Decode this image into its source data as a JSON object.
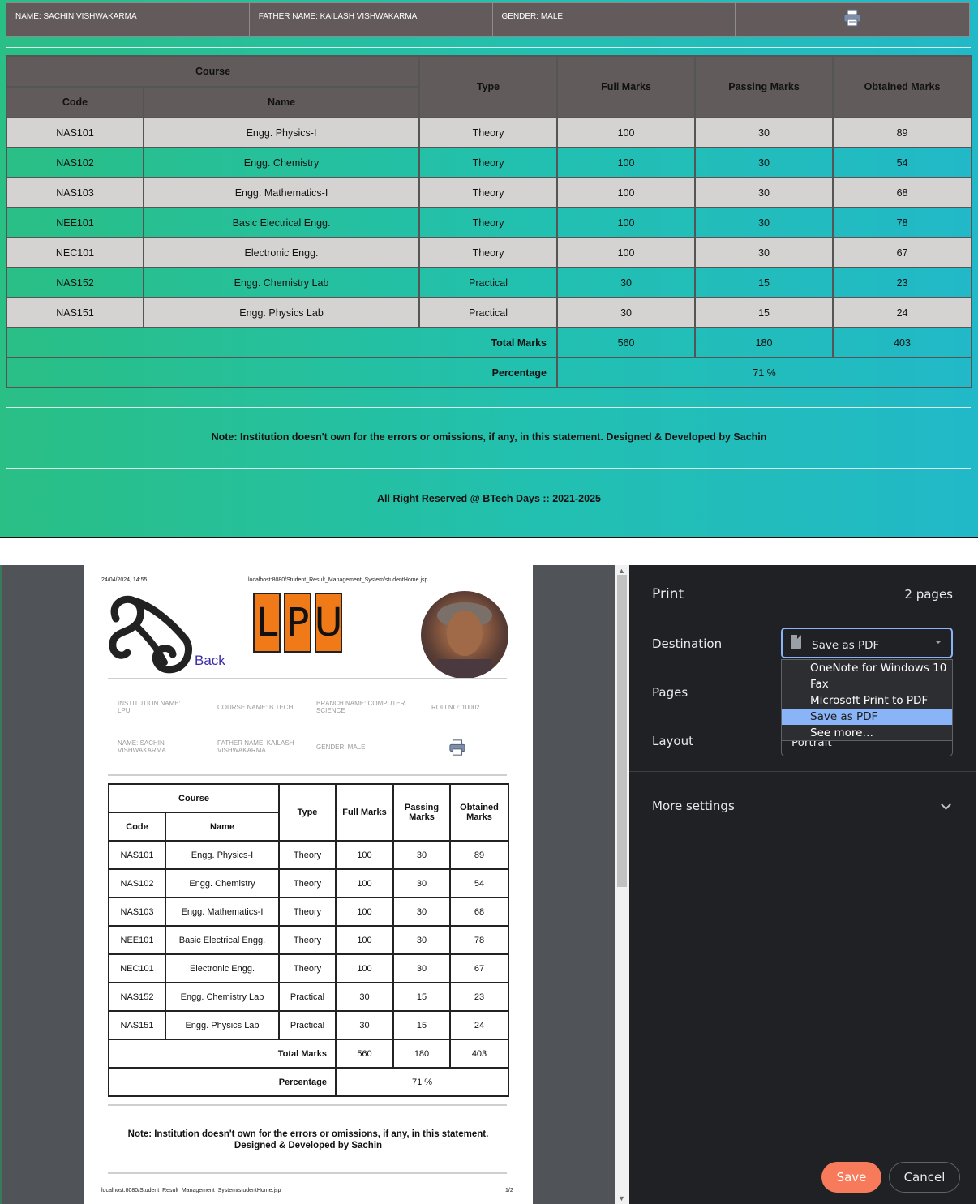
{
  "web": {
    "info": {
      "name": "NAME: SACHIN VISHWAKARMA",
      "father": "FATHER NAME: KAILASH VISHWAKARMA",
      "gender": "GENDER: MALE"
    },
    "table": {
      "headers": {
        "course": "Course",
        "code": "Code",
        "name": "Name",
        "type": "Type",
        "full": "Full Marks",
        "passing": "Passing Marks",
        "obtained": "Obtained Marks"
      },
      "rows": [
        {
          "code": "NAS101",
          "name": "Engg. Physics-I",
          "type": "Theory",
          "full": "100",
          "passing": "30",
          "obtained": "89"
        },
        {
          "code": "NAS102",
          "name": "Engg. Chemistry",
          "type": "Theory",
          "full": "100",
          "passing": "30",
          "obtained": "54"
        },
        {
          "code": "NAS103",
          "name": "Engg. Mathematics-I",
          "type": "Theory",
          "full": "100",
          "passing": "30",
          "obtained": "68"
        },
        {
          "code": "NEE101",
          "name": "Basic Electrical Engg.",
          "type": "Theory",
          "full": "100",
          "passing": "30",
          "obtained": "78"
        },
        {
          "code": "NEC101",
          "name": "Electronic Engg.",
          "type": "Theory",
          "full": "100",
          "passing": "30",
          "obtained": "67"
        },
        {
          "code": "NAS152",
          "name": "Engg. Chemistry Lab",
          "type": "Practical",
          "full": "30",
          "passing": "15",
          "obtained": "23"
        },
        {
          "code": "NAS151",
          "name": "Engg. Physics Lab",
          "type": "Practical",
          "full": "30",
          "passing": "15",
          "obtained": "24"
        }
      ],
      "total_label": "Total Marks",
      "total_full": "560",
      "total_passing": "180",
      "total_obtained": "403",
      "percentage_label": "Percentage",
      "percentage": "71 %"
    },
    "note": "Note: Institution doesn't own for the errors or omissions, if any, in this statement. Designed & Developed by Sachin",
    "footer": "All Right Reserved @ BTech Days :: 2021-2025"
  },
  "preview": {
    "datetime": "24/04/2024, 14:55",
    "url": "localhost:8080/Student_Result_Management_System/studentHome.jsp",
    "back_link": "Back",
    "logo_letters": [
      "L",
      "P",
      "U"
    ],
    "info": {
      "institution": "INSTITUTION NAME: LPU",
      "course": "COURSE NAME: B.TECH",
      "branch": "BRANCH NAME: COMPUTER SCIENCE",
      "rollno": "ROLLNO: 10002",
      "name": "NAME: SACHIN VISHWAKARMA",
      "father": "FATHER NAME: KAILASH VISHWAKARMA",
      "gender": "GENDER: MALE"
    },
    "table": {
      "headers": {
        "course": "Course",
        "code": "Code",
        "name": "Name",
        "type": "Type",
        "full": "Full Marks",
        "passing": "Passing Marks",
        "obtained": "Obtained Marks"
      }
    },
    "note_line1": "Note: Institution doesn't own for the errors or omissions, if any, in this statement.",
    "note_line2": "Designed & Developed by Sachin",
    "footer_url": "localhost:8080/Student_Result_Management_System/studentHome.jsp",
    "page_num": "1/2"
  },
  "dialog": {
    "title": "Print",
    "pages_count": "2 pages",
    "destination_label": "Destination",
    "destination_value": "Save as PDF",
    "destination_options": [
      "OneNote for Windows 10",
      "Fax",
      "Microsoft Print to PDF",
      "Save as PDF",
      "See more…"
    ],
    "selected_option": "Save as PDF",
    "pages_label": "Pages",
    "layout_label": "Layout",
    "layout_value": "Portrait",
    "more_settings": "More settings",
    "save_button": "Save",
    "cancel_button": "Cancel"
  },
  "colors": {
    "gradient_start": "#2abf85",
    "gradient_end": "#21b9c8",
    "header_bg": "#625b5b",
    "row_gray": "#d5d3d2",
    "save_button": "#f77b5b",
    "dialog_bg": "#202124",
    "highlight": "#8ab4f8",
    "logo_orange": "#f07a18"
  }
}
